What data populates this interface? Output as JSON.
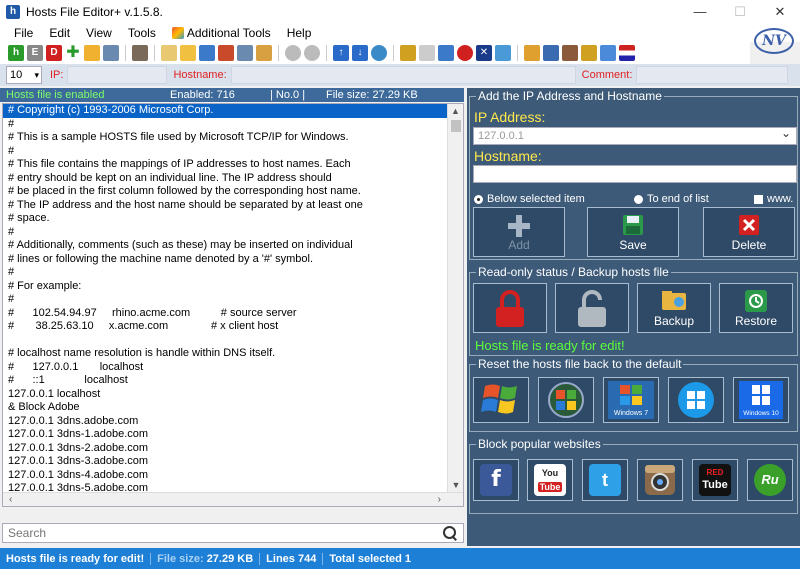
{
  "window": {
    "title": "Hosts File Editor+ v.1.5.8.",
    "minimize": "—",
    "maximize": "☐",
    "close": "✕"
  },
  "menu": {
    "items": [
      "File",
      "Edit",
      "View",
      "Tools",
      "Additional Tools",
      "Help"
    ],
    "logo_text": "NV"
  },
  "filter": {
    "count": "10",
    "ip_label": "IP:",
    "hostname_label": "Hostname:",
    "comment_label": "Comment:"
  },
  "infobar": {
    "status": "Hosts file is enabled",
    "enabled": "Enabled: 716",
    "no": "| No.0 |",
    "file_size": "File size: 27.29 KB"
  },
  "list": {
    "lines": [
      "# Copyright (c) 1993-2006 Microsoft Corp.",
      "#",
      "# This is a sample HOSTS file used by Microsoft TCP/IP for Windows.",
      "#",
      "# This file contains the mappings of IP addresses to host names. Each",
      "# entry should be kept on an individual line. The IP address should",
      "# be placed in the first column followed by the corresponding host name.",
      "# The IP address and the host name should be separated by at least one",
      "# space.",
      "#",
      "# Additionally, comments (such as these) may be inserted on individual",
      "# lines or following the machine name denoted by a '#' symbol.",
      "#",
      "# For example:",
      "#",
      "#      102.54.94.97     rhino.acme.com          # source server",
      "#       38.25.63.10     x.acme.com              # x client host",
      "",
      "# localhost name resolution is handle within DNS itself.",
      "#      127.0.0.1       localhost",
      "#      ::1             localhost",
      "127.0.0.1 localhost",
      "& Block Adobe",
      "127.0.0.1 3dns.adobe.com",
      "127.0.0.1 3dns-1.adobe.com",
      "127.0.0.1 3dns-2.adobe.com",
      "127.0.0.1 3dns-3.adobe.com",
      "127.0.0.1 3dns-4.adobe.com",
      "127.0.0.1 3dns-5.adobe.com",
      "127.0.0.1 activate.adobe.com"
    ],
    "selected_index": 0
  },
  "search": {
    "placeholder": "Search"
  },
  "add_group": {
    "title": "Add the IP Address  and Hostname",
    "ip_label": "IP Address:",
    "ip_value": "127.0.0.1",
    "hostname_label": "Hostname:",
    "hostname_value": "",
    "radio_below": "Below selected item",
    "radio_end": "To end of list",
    "www_label": "www.",
    "add_label": "Add",
    "save_label": "Save",
    "delete_label": "Delete"
  },
  "readonly_group": {
    "title": "Read-only status / Backup hosts file",
    "backup_label": "Backup",
    "restore_label": "Restore",
    "ready_text": "Hosts file is ready for edit!"
  },
  "reset_group": {
    "title": "Reset the hosts file back to the default",
    "logos": [
      "Windows XP",
      "Vista",
      "Windows 7",
      "Windows 8",
      "Windows 10"
    ]
  },
  "block_group": {
    "title": "Block popular websites",
    "sites": [
      "Facebook",
      "YouTube",
      "Twitter",
      "Instagram",
      "RED Tube",
      "RuTracker"
    ]
  },
  "statusbar": {
    "ready": "Hosts file is ready for edit!",
    "file_size_label": "File size:",
    "file_size": "27.29 KB",
    "lines": "Lines 744",
    "selected": "Total selected 1"
  },
  "colors": {
    "accent": "#1e7fd6",
    "panel": "#3d5a78",
    "selected": "#0a64c8",
    "ready_green": "#5cff3c",
    "field_yellow": "#ffe94a",
    "delete_red": "#d32020"
  }
}
